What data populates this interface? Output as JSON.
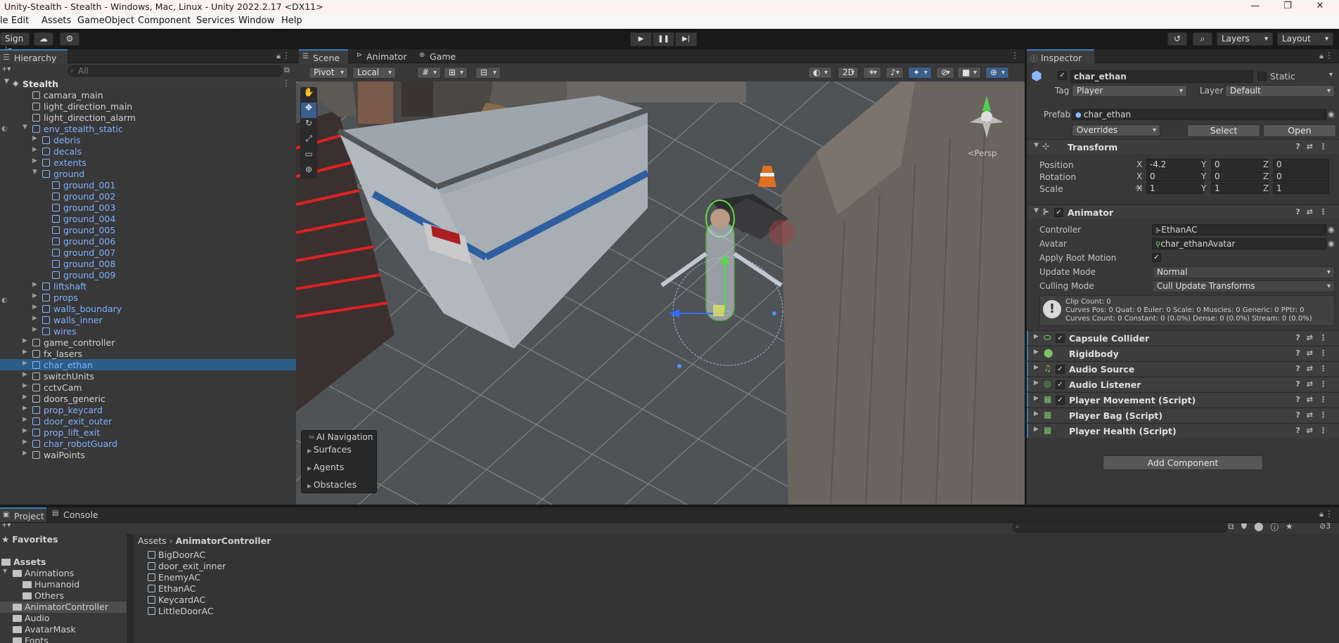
{
  "window": {
    "title": "Unity-Stealth - Stealth - Windows, Mac, Linux - Unity 2022.2.17 <DX11>"
  },
  "menu": [
    "le",
    "Edit",
    "Assets",
    "GameObject",
    "Component",
    "Services",
    "Window",
    "Help"
  ],
  "toolbar": {
    "sign_in": "Sign in",
    "layers": "Layers",
    "layout": "Layout"
  },
  "hierarchy": {
    "tab": "Hierarchy",
    "search_placeholder": "All",
    "scene": "Stealth",
    "rows": [
      {
        "label": "camara_main",
        "depth": 1,
        "blue": false,
        "arrow": ""
      },
      {
        "label": "light_direction_main",
        "depth": 1,
        "blue": false,
        "arrow": ""
      },
      {
        "label": "light_direction_alarm",
        "depth": 1,
        "blue": false,
        "arrow": ""
      },
      {
        "label": "env_stealth_static",
        "depth": 1,
        "blue": true,
        "arrow": "▼"
      },
      {
        "label": "debris",
        "depth": 2,
        "blue": true,
        "arrow": "▶"
      },
      {
        "label": "decals",
        "depth": 2,
        "blue": true,
        "arrow": "▶"
      },
      {
        "label": "extents",
        "depth": 2,
        "blue": true,
        "arrow": "▶"
      },
      {
        "label": "ground",
        "depth": 2,
        "blue": true,
        "arrow": "▼"
      },
      {
        "label": "ground_001",
        "depth": 3,
        "blue": true,
        "arrow": ""
      },
      {
        "label": "ground_002",
        "depth": 3,
        "blue": true,
        "arrow": ""
      },
      {
        "label": "ground_003",
        "depth": 3,
        "blue": true,
        "arrow": ""
      },
      {
        "label": "ground_004",
        "depth": 3,
        "blue": true,
        "arrow": ""
      },
      {
        "label": "ground_005",
        "depth": 3,
        "blue": true,
        "arrow": ""
      },
      {
        "label": "ground_006",
        "depth": 3,
        "blue": true,
        "arrow": ""
      },
      {
        "label": "ground_007",
        "depth": 3,
        "blue": true,
        "arrow": ""
      },
      {
        "label": "ground_008",
        "depth": 3,
        "blue": true,
        "arrow": ""
      },
      {
        "label": "ground_009",
        "depth": 3,
        "blue": true,
        "arrow": ""
      },
      {
        "label": "liftshaft",
        "depth": 2,
        "blue": true,
        "arrow": "▶"
      },
      {
        "label": "props",
        "depth": 2,
        "blue": true,
        "arrow": "▶"
      },
      {
        "label": "walls_boundary",
        "depth": 2,
        "blue": true,
        "arrow": "▶"
      },
      {
        "label": "walls_inner",
        "depth": 2,
        "blue": true,
        "arrow": "▶"
      },
      {
        "label": "wires",
        "depth": 2,
        "blue": true,
        "arrow": "▶"
      },
      {
        "label": "game_controller",
        "depth": 1,
        "blue": false,
        "arrow": "▶"
      },
      {
        "label": "fx_lasers",
        "depth": 1,
        "blue": false,
        "arrow": "▶"
      },
      {
        "label": "char_ethan",
        "depth": 1,
        "blue": true,
        "arrow": "▶",
        "selected": true
      },
      {
        "label": "switchUnits",
        "depth": 1,
        "blue": false,
        "arrow": "▶"
      },
      {
        "label": "cctvCam",
        "depth": 1,
        "blue": false,
        "arrow": "▶"
      },
      {
        "label": "doors_generic",
        "depth": 1,
        "blue": false,
        "arrow": "▶"
      },
      {
        "label": "prop_keycard",
        "depth": 1,
        "blue": true,
        "arrow": "▶"
      },
      {
        "label": "door_exit_outer",
        "depth": 1,
        "blue": true,
        "arrow": "▶"
      },
      {
        "label": "prop_lift_exit",
        "depth": 1,
        "blue": true,
        "arrow": "▶"
      },
      {
        "label": "char_robotGuard",
        "depth": 1,
        "blue": true,
        "arrow": "▶"
      },
      {
        "label": "waiPoints",
        "depth": 1,
        "blue": false,
        "arrow": "▶"
      }
    ]
  },
  "scene": {
    "tabs": [
      "Scene",
      "Animator",
      "Game"
    ],
    "pivot": "Pivot",
    "local": "Local",
    "mode2d": "2D",
    "persp": "<Persp",
    "ai_nav": {
      "title": "AI Navigation",
      "items": [
        "Surfaces",
        "Agents",
        "Obstacles"
      ]
    }
  },
  "inspector": {
    "tab": "Inspector",
    "object_name": "char_ethan",
    "static": "Static",
    "tag_label": "Tag",
    "tag": "Player",
    "layer_label": "Layer",
    "layer": "Default",
    "prefab_label": "Prefab",
    "prefab": "char_ethan",
    "overrides": "Overrides",
    "select": "Select",
    "open": "Open",
    "transform": {
      "title": "Transform",
      "position_label": "Position",
      "rotation_label": "Rotation",
      "scale_label": "Scale",
      "position": [
        "-4.2",
        "0",
        "0"
      ],
      "rotation": [
        "0",
        "0",
        "0"
      ],
      "scale": [
        "1",
        "1",
        "1"
      ],
      "axes": [
        "X",
        "Y",
        "Z"
      ]
    },
    "animator": {
      "title": "Animator",
      "controller_label": "Controller",
      "controller": "EthanAC",
      "avatar_label": "Avatar",
      "avatar": "char_ethanAvatar",
      "root_motion_label": "Apply Root Motion",
      "update_label": "Update Mode",
      "update": "Normal",
      "culling_label": "Culling Mode",
      "culling": "Cull Update Transforms",
      "info": [
        "Clip Count: 0",
        "Curves Pos: 0 Quat: 0 Euler: 0 Scale: 0 Muscles: 0 Generic: 0 PPtr: 0",
        "Curves Count: 0 Constant: 0 (0.0%) Dense: 0 (0.0%) Stream: 0 (0.0%)"
      ]
    },
    "components": [
      {
        "name": "Capsule Collider",
        "check": true
      },
      {
        "name": "Rigidbody",
        "check": false
      },
      {
        "name": "Audio Source",
        "check": true
      },
      {
        "name": "Audio Listener",
        "check": true
      },
      {
        "name": "Player Movement (Script)",
        "check": true
      },
      {
        "name": "Player Bag (Script)",
        "check": false
      },
      {
        "name": "Player Health (Script)",
        "check": false
      }
    ],
    "add_component": "Add Component"
  },
  "project": {
    "tabs": [
      "Project",
      "Console"
    ],
    "favorites": "Favorites",
    "assets": "Assets",
    "tree": [
      {
        "label": "Animations",
        "depth": 1,
        "arrow": "▼"
      },
      {
        "label": "Humanoid",
        "depth": 2,
        "arrow": ""
      },
      {
        "label": "Others",
        "depth": 2,
        "arrow": ""
      },
      {
        "label": "AnimatorController",
        "depth": 1,
        "arrow": "",
        "selected": true
      },
      {
        "label": "Audio",
        "depth": 1,
        "arrow": ""
      },
      {
        "label": "AvatarMask",
        "depth": 1,
        "arrow": ""
      },
      {
        "label": "Fonts",
        "depth": 1,
        "arrow": ""
      }
    ],
    "breadcrumb": [
      "Assets",
      "AnimatorController"
    ],
    "files": [
      "BigDoorAC",
      "door_exit_inner",
      "EnemyAC",
      "EthanAC",
      "KeycardAC",
      "LittleDoorAC"
    ],
    "hidden_count": "3"
  }
}
